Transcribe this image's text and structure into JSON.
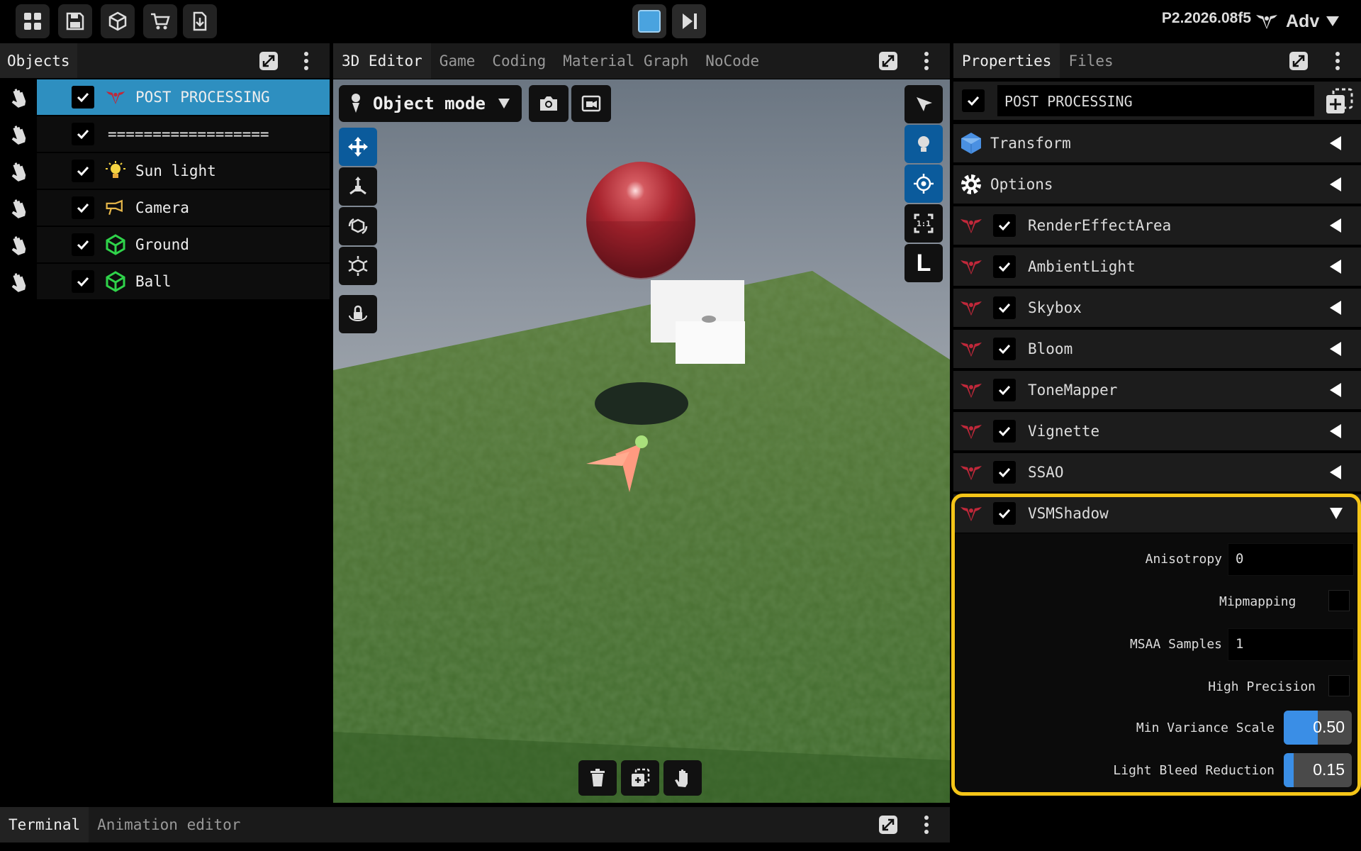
{
  "toolbar": {
    "buttons": [
      "grid-icon",
      "save-icon",
      "cube-icon",
      "cart-icon",
      "download-icon"
    ],
    "stop_icon": "stop-icon",
    "step_icon": "step-forward-icon",
    "version": "P2.2026.08f5",
    "user_label": "Adv"
  },
  "objects_panel": {
    "tab": "Objects",
    "items": [
      {
        "label": "POST PROCESSING",
        "icon": "postprocess-icon",
        "checked": true,
        "selected": true
      },
      {
        "label": "==================",
        "icon": "",
        "checked": true
      },
      {
        "label": "Sun light",
        "icon": "bulb-icon",
        "checked": true
      },
      {
        "label": "Camera",
        "icon": "camera-icon",
        "checked": true
      },
      {
        "label": "Ground",
        "icon": "mesh-icon",
        "checked": true
      },
      {
        "label": "Ball",
        "icon": "mesh-icon",
        "checked": true
      }
    ]
  },
  "editor": {
    "tabs": [
      "3D Editor",
      "Game",
      "Coding",
      "Material Graph",
      "NoCode"
    ],
    "active_tab": "3D Editor",
    "mode": "Object mode",
    "right_tool_letter": "L",
    "ratio_label": "1:1"
  },
  "properties": {
    "tabs": [
      "Properties",
      "Files"
    ],
    "active_tab": "Properties",
    "object_name": "POST PROCESSING",
    "sections": [
      {
        "label": "Transform",
        "icon": "cube-icon"
      },
      {
        "label": "Options",
        "icon": "gear-icon"
      }
    ],
    "components": [
      {
        "label": "RenderEffectArea",
        "checked": true
      },
      {
        "label": "AmbientLight",
        "checked": true
      },
      {
        "label": "Skybox",
        "checked": true
      },
      {
        "label": "Bloom",
        "checked": true
      },
      {
        "label": "ToneMapper",
        "checked": true
      },
      {
        "label": "Vignette",
        "checked": true
      },
      {
        "label": "SSAO",
        "checked": true
      },
      {
        "label": "VSMShadow",
        "checked": true,
        "expanded": true
      }
    ],
    "vsm_fields": {
      "anisotropy_label": "Anisotropy",
      "anisotropy_value": "0",
      "mipmapping_label": "Mipmapping",
      "mipmapping_checked": false,
      "msaa_label": "MSAA Samples",
      "msaa_value": "1",
      "high_precision_label": "High Precision",
      "high_precision_checked": false,
      "min_variance_label": "Min Variance Scale",
      "min_variance_value": "0.50",
      "min_variance_fraction": 0.5,
      "light_bleed_label": "Light Bleed Reduction",
      "light_bleed_value": "0.15",
      "light_bleed_fraction": 0.15
    },
    "highlight_color": "#f5c518"
  },
  "bottom": {
    "tabs": [
      "Terminal",
      "Animation editor"
    ],
    "active_tab": "Terminal"
  },
  "colors": {
    "selection": "#2e8fc0",
    "accent_blue": "#0b5b9c",
    "slider_blue": "#3a8ee6",
    "postprocess_red": "#c0283a",
    "mesh_green": "#2fd34a"
  }
}
